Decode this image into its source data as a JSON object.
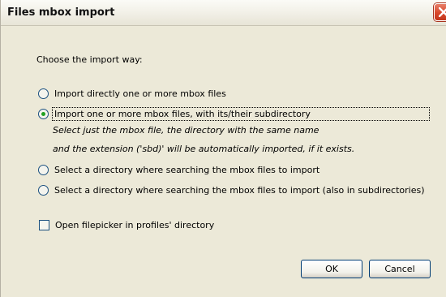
{
  "window": {
    "title": "Files mbox import"
  },
  "prompt": "Choose the import way:",
  "options": [
    {
      "label": "Import directly one or more mbox files",
      "selected": false
    },
    {
      "label": "Import one or more mbox files, with its/their subdirectory",
      "selected": true
    },
    {
      "label": "Select a directory where searching the mbox files to import",
      "selected": false
    },
    {
      "label": "Select a directory where searching the mbox files to import (also in subdirectories)",
      "selected": false
    }
  ],
  "description": {
    "line1": "Select just the mbox file, the directory with the same name",
    "line2": "and the extension ('sbd)' will be automatically imported, if it exists."
  },
  "checkbox": {
    "label": "Open filepicker in profiles' directory",
    "checked": false
  },
  "buttons": {
    "ok": "OK",
    "cancel": "Cancel"
  },
  "colors": {
    "dialog_bg": "#ece9d8",
    "radio_selected": "#21a121",
    "close_button": "#d8472a"
  },
  "icons": {
    "close": "close-x-icon"
  }
}
